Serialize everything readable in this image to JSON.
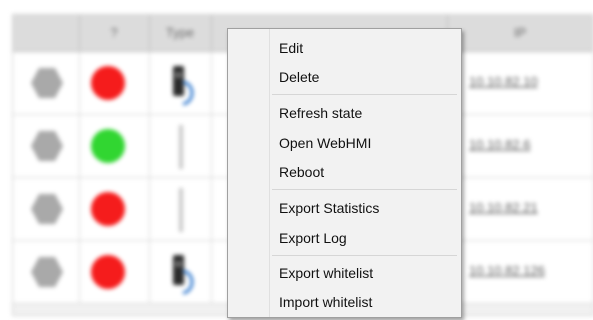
{
  "table": {
    "headers": [
      "",
      "?",
      "Type",
      "",
      "IP"
    ],
    "rows": [
      {
        "status": "red",
        "ip": "10.10.82.10",
        "device_icon": "device-icon"
      },
      {
        "status": "green",
        "ip": "10.10.82.6",
        "device_icon": "device-icon"
      },
      {
        "status": "red",
        "ip": "10.10.82.21",
        "device_icon": "device-icon"
      },
      {
        "status": "red",
        "ip": "10.10.82.126",
        "device_icon": "device-icon"
      }
    ]
  },
  "context_menu": {
    "items": [
      {
        "label": "Edit"
      },
      {
        "label": "Delete"
      },
      {
        "label": "Refresh state"
      },
      {
        "label": "Open WebHMI"
      },
      {
        "label": "Reboot"
      },
      {
        "label": "Export Statistics"
      },
      {
        "label": "Export Log"
      },
      {
        "label": "Export whitelist"
      },
      {
        "label": "Import whitelist"
      }
    ]
  },
  "colors": {
    "status_red": "#f51c1c",
    "status_green": "#31d631",
    "menu_bg": "#f2f2f2"
  }
}
